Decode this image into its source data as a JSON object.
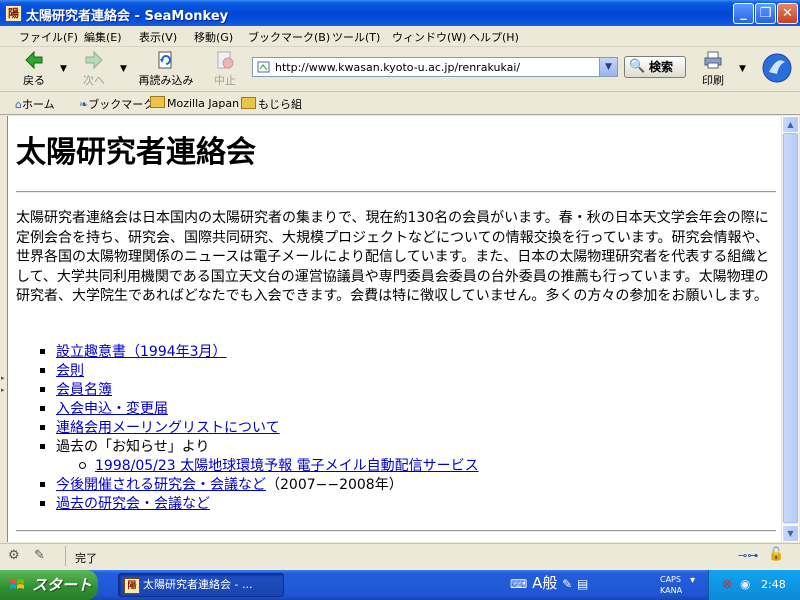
{
  "window": {
    "title": "太陽研究者連絡会 - SeaMonkey"
  },
  "menu": [
    "ファイル(F)",
    "編集(E)",
    "表示(V)",
    "移動(G)",
    "ブックマーク(B)",
    "ツール(T)",
    "ウィンドウ(W)",
    "ヘルプ(H)"
  ],
  "nav": {
    "back": "戻る",
    "forward": "次へ",
    "reload": "再読み込み",
    "stop": "中止",
    "search": "検索",
    "print": "印刷",
    "url": "http://www.kwasan.kyoto-u.ac.jp/renrakukai/"
  },
  "personal": {
    "home": "ホーム",
    "bookmarks": "ブックマーク",
    "mozilla": "Mozilla Japan",
    "mojira": "もじら組"
  },
  "page": {
    "title": "太陽研究者連絡会",
    "intro": "太陽研究者連絡会は日本国内の太陽研究者の集まりで、現在約130名の会員がいます。春・秋の日本天文学会年会の際に定例会合を持ち、研究会、国際共同研究、大規模プロジェクトなどについての情報交換を行っています。研究会情報や、世界各国の太陽物理関係のニュースは電子メールにより配信しています。また、日本の太陽物理研究者を代表する組織として、大学共同利用機関である国立天文台の運営協議員や専門委員会委員の台外委員の推薦も行っています。太陽物理の研究者、大学院生であればどなたでも入会できます。会費は特に徴収していません。多くの方々の参加をお願いします。",
    "links": {
      "l1": "設立趣意書（1994年3月）",
      "l2": "会則",
      "l3": "会員名簿",
      "l4": "入会申込・変更届",
      "l5": "連絡会用メーリングリストについて",
      "l6": "過去の「お知らせ」より",
      "l6a": "1998/05/23 太陽地球環境予報 電子メイル自動配信サービス",
      "l7": "今後開催される研究会・会議など",
      "l7_suffix": "（2007−−2008年）",
      "l8": "過去の研究会・会議など"
    }
  },
  "status": {
    "text": "完了"
  },
  "taskbar": {
    "start": "スタート",
    "task": "太陽研究者連絡会 - ...",
    "ime": "A般",
    "caps": "CAPS",
    "kana": "KANA",
    "clock": "2:48"
  }
}
